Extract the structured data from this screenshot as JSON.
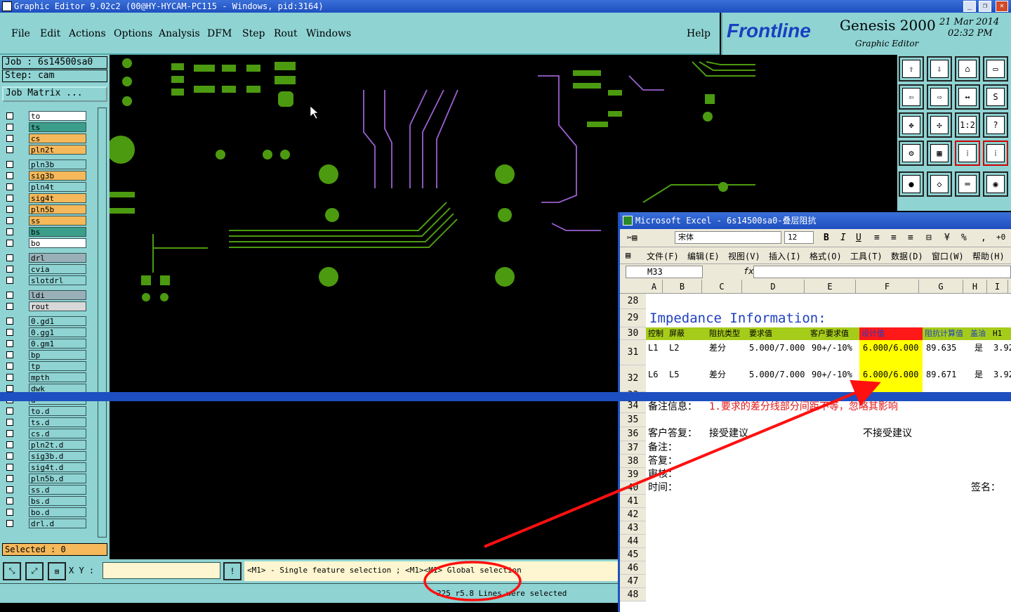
{
  "window": {
    "title": "Graphic Editor 9.02c2 (00@HY-HYCAM-PC115 - Windows, pid:3164)"
  },
  "menu": {
    "items": [
      "File",
      "Edit",
      "Actions",
      "Options",
      "Analysis",
      "DFM",
      "Step",
      "Rout",
      "Windows"
    ],
    "help": "Help"
  },
  "brand": {
    "logo": "Frontline",
    "product": "Genesis 2000",
    "subtitle": "Graphic Editor",
    "date": "21 Mar 2014",
    "time": "02:32 PM"
  },
  "job": {
    "label": "Job : 6s14500sa0",
    "step": "Step: cam",
    "matrix_button": "Job Matrix ..."
  },
  "layers": [
    {
      "name": "to",
      "color": "#ffffff"
    },
    {
      "name": "ts",
      "color": "#3a9e8a"
    },
    {
      "name": "cs",
      "color": "#f5b85a"
    },
    {
      "name": "pln2t",
      "color": "#f5b85a"
    },
    {
      "name": "pln3b",
      "color": "#8fd3d3"
    },
    {
      "name": "sig3b",
      "color": "#f5b85a"
    },
    {
      "name": "pln4t",
      "color": "#8fd3d3"
    },
    {
      "name": "sig4t",
      "color": "#f5b85a"
    },
    {
      "name": "pln5b",
      "color": "#f5b85a"
    },
    {
      "name": "ss",
      "color": "#f5b85a"
    },
    {
      "name": "bs",
      "color": "#3a9e8a"
    },
    {
      "name": "bo",
      "color": "#ffffff"
    },
    {
      "name": "drl",
      "color": "#9ab0b8"
    },
    {
      "name": "cvia",
      "color": "#8fd3d3"
    },
    {
      "name": "slotdrl",
      "color": "#8fd3d3"
    },
    {
      "name": "ldi",
      "color": "#9ab0b8"
    },
    {
      "name": "rout",
      "color": "#d8d8d8"
    },
    {
      "name": "0.gd1",
      "color": "#8fd3d3"
    },
    {
      "name": "0.gg1",
      "color": "#8fd3d3"
    },
    {
      "name": "0.gm1",
      "color": "#8fd3d3"
    },
    {
      "name": "bp",
      "color": "#8fd3d3"
    },
    {
      "name": "tp",
      "color": "#8fd3d3"
    },
    {
      "name": "mpth",
      "color": "#8fd3d3"
    },
    {
      "name": "dwk",
      "color": "#8fd3d3"
    },
    {
      "name": "d",
      "color": "#8fd3d3"
    },
    {
      "name": "to.d",
      "color": "#8fd3d3"
    },
    {
      "name": "ts.d",
      "color": "#8fd3d3"
    },
    {
      "name": "cs.d",
      "color": "#8fd3d3"
    },
    {
      "name": "pln2t.d",
      "color": "#8fd3d3"
    },
    {
      "name": "sig3b.d",
      "color": "#8fd3d3"
    },
    {
      "name": "sig4t.d",
      "color": "#8fd3d3"
    },
    {
      "name": "pln5b.d",
      "color": "#8fd3d3"
    },
    {
      "name": "ss.d",
      "color": "#8fd3d3"
    },
    {
      "name": "bs.d",
      "color": "#8fd3d3"
    },
    {
      "name": "bo.d",
      "color": "#8fd3d3"
    },
    {
      "name": "drl.d",
      "color": "#8fd3d3"
    }
  ],
  "selected": "Selected : 0",
  "bottom": {
    "xy_label": "X Y :",
    "hint": "<M1> - Single feature selection ; <M1><M1> Global selection",
    "status": "225 r5.8 Lines were selected"
  },
  "excel": {
    "title": "Microsoft Excel - 6s14500sa0-叠层阻抗",
    "font": "宋体",
    "size": "12",
    "menu": [
      "文件(F)",
      "编辑(E)",
      "视图(V)",
      "插入(I)",
      "格式(O)",
      "工具(T)",
      "数据(D)",
      "窗口(W)",
      "帮助(H)"
    ],
    "namebox": "M33",
    "fx": "fx",
    "columns": [
      "A",
      "B",
      "C",
      "D",
      "E",
      "F",
      "G",
      "H",
      "I"
    ],
    "rows": [
      "28",
      "29",
      "30",
      "31",
      "32",
      "33",
      "34",
      "35",
      "36",
      "37",
      "38",
      "39",
      "40",
      "41",
      "42",
      "43",
      "44",
      "45",
      "46",
      "47",
      "48"
    ],
    "heading": "Impedance Information:",
    "header_cells": {
      "a": "控制",
      "b": "屏蔽",
      "c": "阻抗类型",
      "d": "要求值",
      "e": "客户要求值",
      "f": "设计值",
      "g": "阻抗计算值",
      "h": "盖油",
      "i": "H1"
    },
    "row31": {
      "a": "L1",
      "b": "L2",
      "c": "差分",
      "d": "5.000/7.000",
      "e": "90+/-10%",
      "f": "6.000/6.000",
      "g": "89.635",
      "h": "是",
      "i": "3.92"
    },
    "row32": {
      "a": "L6",
      "b": "L5",
      "c": "差分",
      "d": "5.000/7.000",
      "e": "90+/-10%",
      "f": "6.000/6.000",
      "g": "89.671",
      "h": "是",
      "i": "3.92"
    },
    "note_label": "备注信息：",
    "note_text": "1.要求的差分线部分间距不等，忽略其影响",
    "reply_label": "客户答复：",
    "accept": "接受建议",
    "reject": "不接受建议",
    "remark": "备注：",
    "answer": "答复：",
    "review": "审核：",
    "time": "时间：",
    "sign": "签名："
  }
}
